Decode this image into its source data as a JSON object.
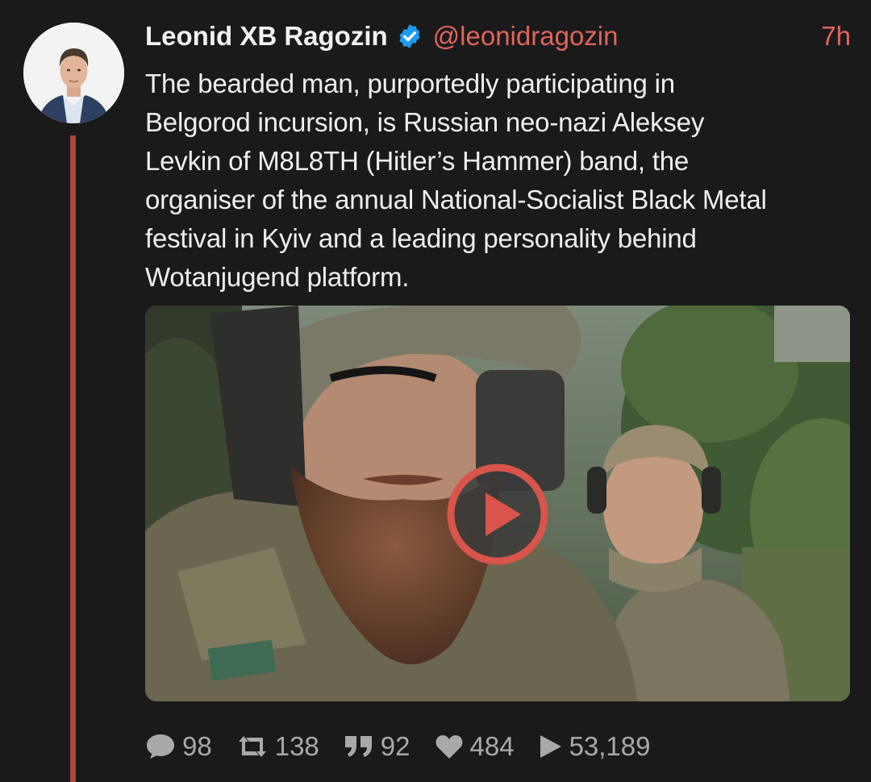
{
  "author": {
    "display_name": "Leonid XB Ragozin",
    "handle": "@leonidragozin",
    "verified_icon": "verified-check-icon",
    "avatar_icon": "profile-avatar"
  },
  "tweet": {
    "time": "7h",
    "text": "The bearded man, purportedly participating in\nBelgorod incursion, is Russian neo-nazi Aleksey\nLevkin of M8L8TH (Hitler’s Hammer) band, the\norganiser of the annual National-Socialist Black Metal\nfestival in Kyiv and a leading personality behind\nWotanjugend platform."
  },
  "media": {
    "type": "video",
    "play_icon": "play-icon"
  },
  "stats": {
    "replies": "98",
    "retweets": "138",
    "quotes": "92",
    "likes": "484",
    "views": "53,189"
  },
  "colors": {
    "background": "#1a1a1a",
    "accent": "#e0655a",
    "thread_line": "#a9483f",
    "verified": "#1d9bf0",
    "muted": "#a9a9a9"
  }
}
